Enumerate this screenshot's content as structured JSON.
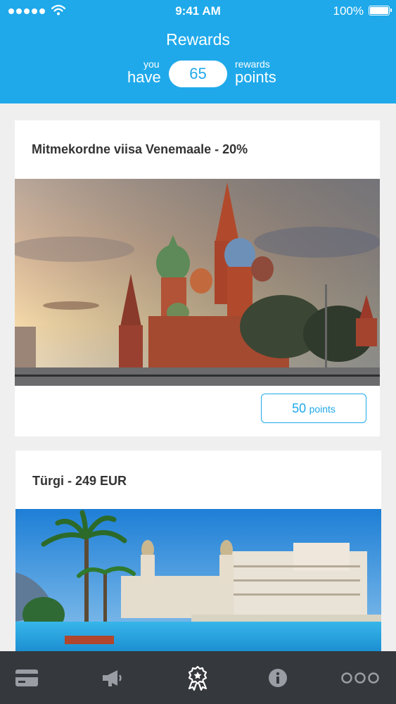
{
  "status_bar": {
    "time": "9:41 AM",
    "battery": "100%",
    "signal_icon": "signal-dots-icon",
    "wifi_icon": "wifi-icon",
    "battery_icon": "battery-icon"
  },
  "header": {
    "title": "Rewards",
    "you_small": "you",
    "you_big": "have",
    "points_value": "65",
    "rewards_small": "rewards",
    "rewards_big": "points"
  },
  "rewards": [
    {
      "title": "Mitmekordne viisa Venemaale - 20%",
      "image": "st-basils-cathedral-moscow-photo",
      "points_value": "50",
      "points_unit": "points"
    },
    {
      "title": "Türgi - 249 EUR",
      "image": "turkey-resort-hotel-pool-photo"
    }
  ],
  "tabbar": {
    "tabs": [
      {
        "icon": "credit-card-icon"
      },
      {
        "icon": "megaphone-icon"
      },
      {
        "icon": "award-ribbon-icon",
        "active": true
      },
      {
        "icon": "info-icon"
      },
      {
        "icon": "more-dots-icon"
      }
    ]
  },
  "colors": {
    "accent": "#1fa9ea",
    "tabbar_bg": "#35383d",
    "tab_icon": "#9a9ea4",
    "tab_active_icon": "#ffffff",
    "background": "#efefef"
  }
}
